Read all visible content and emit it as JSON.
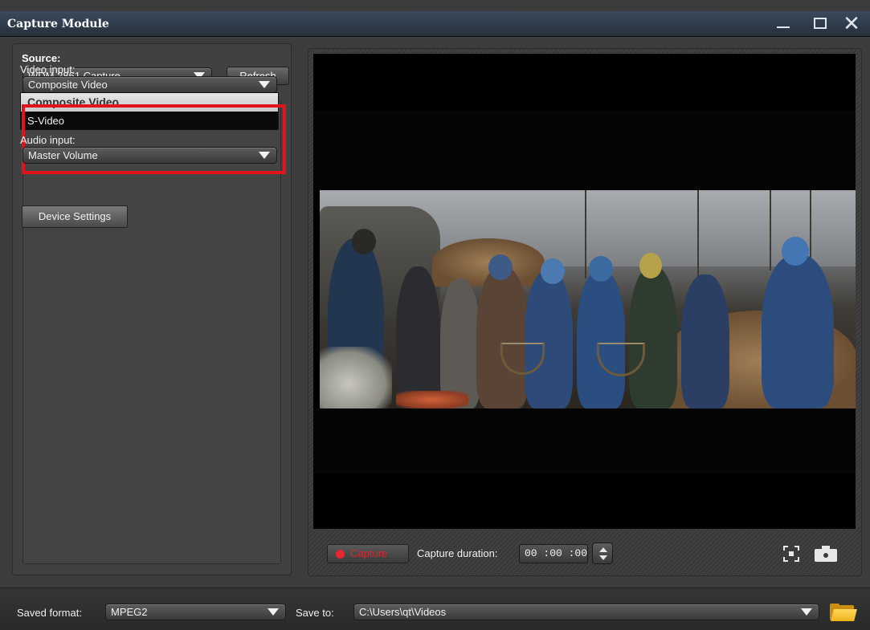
{
  "window": {
    "title": "Capture Module"
  },
  "source": {
    "label": "Source:",
    "selected": "WDM 2861 Capture",
    "refresh_label": "Refresh"
  },
  "video_input": {
    "label": "Video input:",
    "selected": "Composite Video",
    "options": [
      "Composite Video",
      "S-Video"
    ]
  },
  "audio_input": {
    "label": "Audio input:",
    "selected": "Master Volume"
  },
  "device_settings_label": "Device Settings",
  "controls": {
    "capture_label": "Capture",
    "duration_label": "Capture duration:",
    "duration_value": "00 :00 :00"
  },
  "footer": {
    "saved_format_label": "Saved format:",
    "saved_format_value": "MPEG2",
    "save_to_label": "Save to:",
    "save_to_path": "C:\\Users\\qt\\Videos"
  },
  "colors": {
    "highlight": "#e0141a",
    "capture_red": "#e5202a",
    "folder_yellow": "#f0b21e"
  }
}
